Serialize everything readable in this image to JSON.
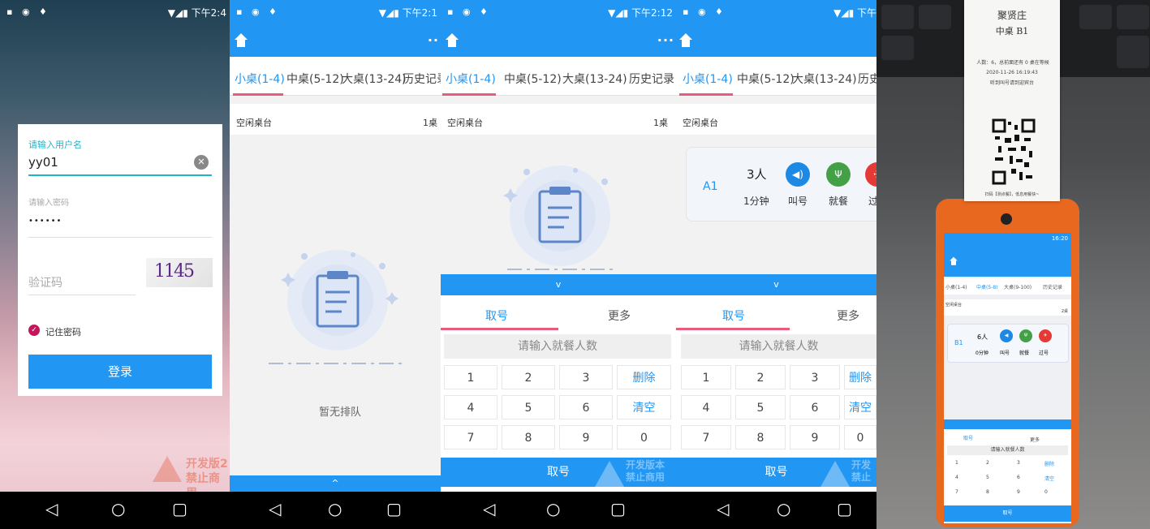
{
  "panel1": {
    "status_time": "下午2:4",
    "username_label": "请输入用户名",
    "username_value": "yy01",
    "password_placeholder": "请输入密码",
    "password_value": "••••••",
    "captcha_placeholder": "验证码",
    "captcha_text": "1145",
    "remember_label": "记住密码",
    "login_label": "登录",
    "watermark_line1": "开发版2",
    "watermark_line2": "禁止商用"
  },
  "panel2": {
    "status_time": "下午2:1",
    "tabs": [
      "小桌(1-4)",
      "中桌(5-12)",
      "大桌(13-24)",
      "历史记录"
    ],
    "free_label": "空闲桌台",
    "free_count": "1桌",
    "empty_text": "暂无排队",
    "expand_arrow": "^"
  },
  "panel3": {
    "status_time": "下午2:12",
    "tabs": [
      "小桌(1-4)",
      "中桌(5-12)",
      "大桌(13-24)",
      "历史记录"
    ],
    "free_label": "空闲桌台",
    "free_count": "1桌",
    "collapse_arrow": "v",
    "numpad_tabs": [
      "取号",
      "更多"
    ],
    "prompt": "请输入就餐人数",
    "keys": [
      "1",
      "2",
      "3",
      "删除",
      "4",
      "5",
      "6",
      "清空",
      "7",
      "8",
      "9",
      "0"
    ],
    "take_label": "取号",
    "watermark_line1": "开发版本",
    "watermark_line2": "禁止商用"
  },
  "panel4": {
    "status_time": "下午",
    "tabs": [
      "小桌(1-4)",
      "中桌(5-12)",
      "大桌(13-24)",
      "历史记录"
    ],
    "free_label": "空闲桌台",
    "queue": {
      "table": "A1",
      "people": "3人",
      "wait": "1分钟",
      "call": "叫号",
      "dine": "就餐",
      "skip": "过号"
    },
    "collapse_arrow": "v",
    "numpad_tabs": [
      "取号",
      "更多"
    ],
    "prompt": "请输入就餐人数",
    "keys": [
      "1",
      "2",
      "3",
      "删除",
      "4",
      "5",
      "6",
      "清空",
      "7",
      "8",
      "9",
      "0"
    ],
    "take_label": "取号",
    "watermark_line1": "开发",
    "watermark_line2": "禁止"
  },
  "panel5": {
    "receipt": {
      "shop": "聚贤庄",
      "table": "中桌 B1",
      "line1": "人数：6，总前面还有 0 桌在等候",
      "line2": "2020-11-26 16:19:43",
      "line3": "听到叫号请到迎宾台",
      "footer": "扫码【测点餐】，低息用餐快~"
    },
    "device": {
      "status_time": "16:20",
      "tabs": [
        "小桌(1-4)",
        "中桌(5-8)",
        "大桌(9-100)",
        "历史记录"
      ],
      "free_label": "空闲桌台",
      "free_count": "2桌",
      "queue": {
        "table": "B1",
        "people": "6人",
        "wait": "0分钟",
        "call": "叫号",
        "dine": "就餐",
        "skip": "过号"
      },
      "numpad_tabs": [
        "取号",
        "更多"
      ],
      "prompt": "请输入就餐人数",
      "keys": [
        "1",
        "2",
        "3",
        "删除",
        "4",
        "5",
        "6",
        "清空",
        "7",
        "8",
        "9",
        "0"
      ],
      "take_label": "取号"
    }
  },
  "colors": {
    "primary": "#2196f3",
    "accent_line": "#e65b7e",
    "login_label_color": "#21b3c9",
    "remember_check": "#c2185b",
    "call_blue": "#1e88e5",
    "dine_green": "#43a047",
    "skip_red": "#e53935",
    "device_orange": "#e8681f"
  },
  "navbar_icons": [
    "back-triangle",
    "home-circle",
    "recents-square"
  ]
}
